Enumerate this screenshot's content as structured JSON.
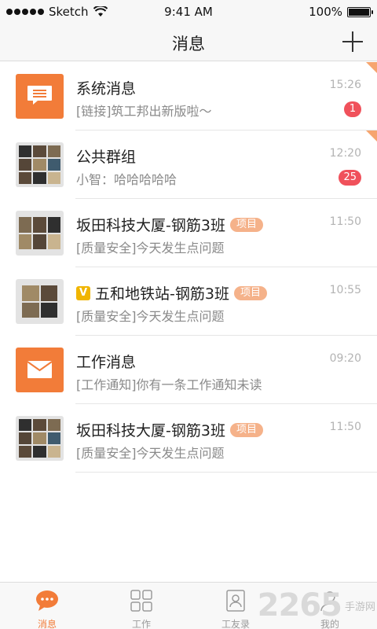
{
  "status_bar": {
    "carrier": "Sketch",
    "time": "9:41 AM",
    "battery": "100%",
    "battery_level": 1.0
  },
  "nav": {
    "title": "消息",
    "add_icon": "plus-icon"
  },
  "conversations": [
    {
      "title": "系统消息",
      "subtitle": "[链接]筑工邦出新版啦～",
      "time": "15:26",
      "badge": "1",
      "icon": "message-icon",
      "pinned": true
    },
    {
      "title": "公共群组",
      "subtitle": "小智：哈哈哈哈哈",
      "time": "12:20",
      "badge": "25",
      "icon": "group-avatar",
      "pinned": true
    },
    {
      "title": "坂田科技大厦-钢筋3班",
      "tag": "项目",
      "subtitle": "[质量安全]今天发生点问题",
      "time": "11:50",
      "icon": "group-avatar"
    },
    {
      "vip": "V",
      "title": "五和地铁站-钢筋3班",
      "tag": "项目",
      "subtitle": "[质量安全]今天发生点问题",
      "time": "10:55",
      "icon": "group-avatar"
    },
    {
      "title": "工作消息",
      "subtitle": "[工作通知]你有一条工作通知未读",
      "time": "09:20",
      "icon": "mail-icon"
    },
    {
      "title": "坂田科技大厦-钢筋3班",
      "tag": "项目",
      "subtitle": "[质量安全]今天发生点问题",
      "time": "11:50",
      "icon": "group-avatar"
    }
  ],
  "tabs": [
    {
      "label": "消息",
      "icon": "chat-bubble-icon",
      "active": true
    },
    {
      "label": "工作",
      "icon": "grid-icon"
    },
    {
      "label": "工友录",
      "icon": "contacts-icon"
    },
    {
      "label": "我的",
      "icon": "profile-icon"
    }
  ],
  "watermark": {
    "number": "2265",
    "text": "手游网"
  },
  "colors": {
    "accent": "#f27c39",
    "badge": "#f0515b",
    "tag": "#f5b28a"
  }
}
